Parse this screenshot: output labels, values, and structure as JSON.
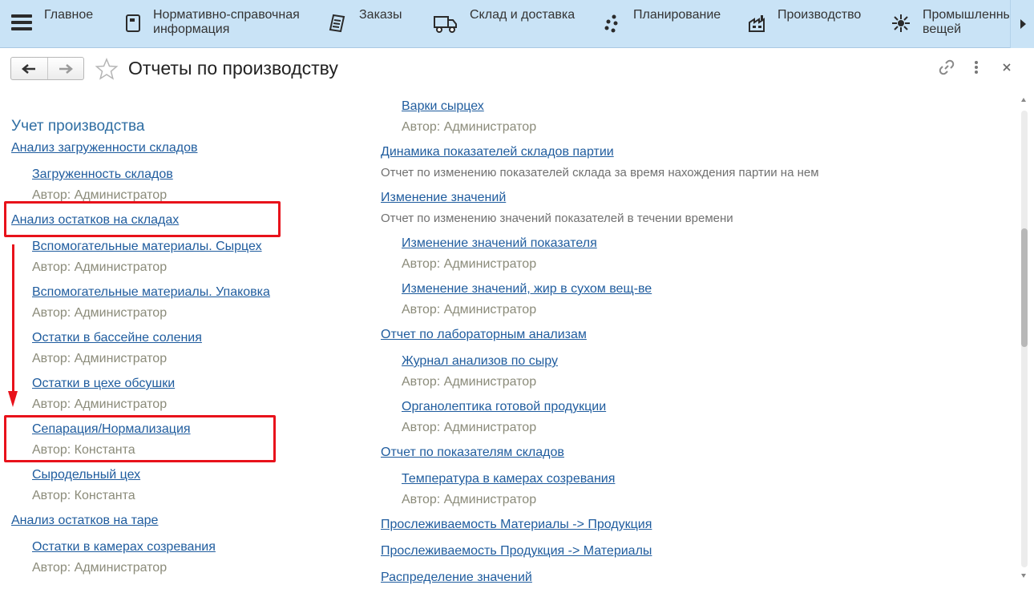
{
  "sections": [
    {
      "label": "Главное",
      "icon": "hamburger-icon"
    },
    {
      "label": "Нормативно-справочная\nинформация",
      "icon": "reference-book-icon"
    },
    {
      "label": "Заказы",
      "icon": "orders-icon"
    },
    {
      "label": "Склад и доставка",
      "icon": "delivery-truck-icon"
    },
    {
      "label": "Планирование",
      "icon": "planning-dots-icon"
    },
    {
      "label": "Производство",
      "icon": "factory-icon"
    },
    {
      "label": "Промышленны\nвещей",
      "icon": "iot-icon"
    }
  ],
  "header": {
    "title": "Отчеты по производству"
  },
  "content": {
    "section_title": "Учет производства",
    "left": [
      {
        "type": "group",
        "text": "Анализ загруженности складов"
      },
      {
        "type": "report",
        "text": "Загруженность складов"
      },
      {
        "type": "author",
        "text": "Автор: Администратор"
      },
      {
        "type": "group",
        "text": "Анализ остатков на складах"
      },
      {
        "type": "report",
        "text": "Вспомогательные материалы. Сырцех"
      },
      {
        "type": "author",
        "text": "Автор: Администратор"
      },
      {
        "type": "report",
        "text": "Вспомогательные материалы. Упаковка"
      },
      {
        "type": "author",
        "text": "Автор: Администратор"
      },
      {
        "type": "report",
        "text": "Остатки в бассейне соления"
      },
      {
        "type": "author",
        "text": "Автор: Администратор"
      },
      {
        "type": "report",
        "text": "Остатки в цехе обсушки"
      },
      {
        "type": "author",
        "text": "Автор: Администратор"
      },
      {
        "type": "report",
        "text": "Сепарация/Нормализация"
      },
      {
        "type": "author",
        "text": "Автор: Константа"
      },
      {
        "type": "report",
        "text": "Сыродельный цех"
      },
      {
        "type": "author",
        "text": "Автор: Константа"
      },
      {
        "type": "group",
        "text": "Анализ остатков на таре"
      },
      {
        "type": "report",
        "text": "Остатки в камерах созревания"
      },
      {
        "type": "author",
        "text": "Автор: Администратор"
      }
    ],
    "right": [
      {
        "type": "report",
        "text": "Варки сырцех"
      },
      {
        "type": "author",
        "text": "Автор: Администратор"
      },
      {
        "type": "group",
        "text": "Динамика показателей складов партии"
      },
      {
        "type": "desc",
        "text": "Отчет по изменению показателей склада за время нахождения партии на нем"
      },
      {
        "type": "group",
        "text": "Изменение значений"
      },
      {
        "type": "desc",
        "text": "Отчет по изменению значений показателей в течении времени"
      },
      {
        "type": "report",
        "text": "Изменение значений показателя"
      },
      {
        "type": "author",
        "text": "Автор: Администратор"
      },
      {
        "type": "report",
        "text": "Изменение значений, жир в сухом вещ-ве"
      },
      {
        "type": "author",
        "text": "Автор: Администратор"
      },
      {
        "type": "group",
        "text": "Отчет по лабораторным анализам"
      },
      {
        "type": "report",
        "text": "Журнал анализов по сыру"
      },
      {
        "type": "author",
        "text": "Автор: Администратор"
      },
      {
        "type": "report",
        "text": "Органолептика готовой продукции"
      },
      {
        "type": "author",
        "text": "Автор: Администратор"
      },
      {
        "type": "group",
        "text": "Отчет по показателям складов"
      },
      {
        "type": "report",
        "text": "Температура в камерах созревания"
      },
      {
        "type": "author",
        "text": "Автор: Администратор"
      },
      {
        "type": "group",
        "text": "Прослеживаемость Материалы -> Продукция"
      },
      {
        "type": "group",
        "text": "Прослеживаемость Продукция -> Материалы"
      },
      {
        "type": "group",
        "text": "Распределение значений"
      }
    ]
  },
  "colors": {
    "link": "#1f5c9e",
    "section_title": "#2f6ea3",
    "author": "#8b8b7a",
    "highlight": "#e8121b",
    "topbar": "#c9e3f6"
  }
}
